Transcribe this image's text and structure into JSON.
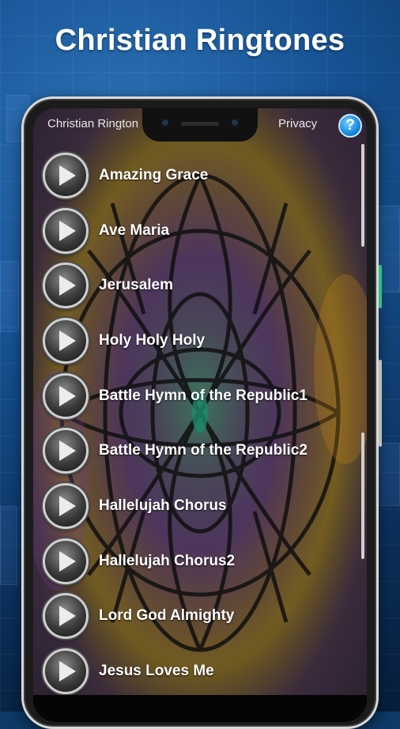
{
  "headline": "Christian Ringtones",
  "appbar": {
    "title": "Christian Rington",
    "privacy_label": "Privacy",
    "help_label": "?"
  },
  "colors": {
    "accent": "#1a8fe0",
    "background": "#175395",
    "text": "#ffffff"
  },
  "ringtones": [
    {
      "label": "Amazing Grace",
      "icon": "play-icon"
    },
    {
      "label": "Ave Maria",
      "icon": "play-icon"
    },
    {
      "label": "Jerusalem",
      "icon": "play-icon"
    },
    {
      "label": "Holy Holy Holy",
      "icon": "play-icon"
    },
    {
      "label": "Battle Hymn of the Republic1",
      "icon": "play-icon"
    },
    {
      "label": "Battle Hymn of the Republic2",
      "icon": "play-icon"
    },
    {
      "label": "Hallelujah Chorus",
      "icon": "play-icon"
    },
    {
      "label": "Hallelujah Chorus2",
      "icon": "play-icon"
    },
    {
      "label": "Lord God Almighty",
      "icon": "play-icon"
    },
    {
      "label": "Jesus Loves Me",
      "icon": "play-icon"
    }
  ]
}
